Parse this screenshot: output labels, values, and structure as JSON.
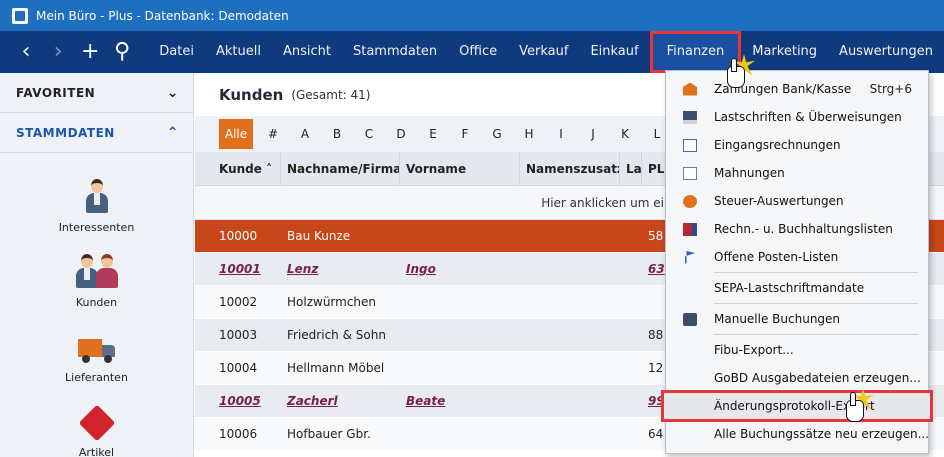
{
  "window": {
    "title": "Mein Büro - Plus - Datenbank: Demodaten"
  },
  "nav": {
    "back": "‹",
    "forward": "›",
    "new": "+",
    "search": "⚲"
  },
  "menu": [
    "Datei",
    "Aktuell",
    "Ansicht",
    "Stammdaten",
    "Office",
    "Verkauf",
    "Einkauf",
    "Finanzen",
    "Marketing",
    "Auswertungen"
  ],
  "sidebar": {
    "favoriten": "FAVORITEN",
    "stammdaten": "STAMMDATEN",
    "items": [
      {
        "label": "Interessenten",
        "icon": "person-icon"
      },
      {
        "label": "Kunden",
        "icon": "customers-icon"
      },
      {
        "label": "Lieferanten",
        "icon": "truck-icon"
      },
      {
        "label": "Artikel",
        "icon": "tag-icon"
      }
    ]
  },
  "main": {
    "title": "Kunden",
    "count": "(Gesamt: 41)",
    "alphabet": [
      "Alle",
      "#",
      "A",
      "B",
      "C",
      "D",
      "E",
      "F",
      "G",
      "H",
      "I",
      "J",
      "K",
      "L"
    ],
    "columns": [
      "Kunde",
      "Nachname/Firma",
      "Vorname",
      "Namenszusatz",
      "La",
      "PL"
    ],
    "filter_hint": "Hier anklicken um ei",
    "rows": [
      {
        "kunde": "10000",
        "name": "Bau Kunze",
        "vorname": "",
        "plz": "58",
        "style": "sel"
      },
      {
        "kunde": "10001",
        "name": "Lenz",
        "vorname": "Ingo",
        "plz": "63",
        "style": "bold"
      },
      {
        "kunde": "10002",
        "name": "Holzwürmchen",
        "vorname": "",
        "plz": "",
        "style": "plain"
      },
      {
        "kunde": "10003",
        "name": "Friedrich & Sohn",
        "vorname": "",
        "plz": "88",
        "style": "alt"
      },
      {
        "kunde": "10004",
        "name": "Hellmann Möbel",
        "vorname": "",
        "plz": "12",
        "style": "plain"
      },
      {
        "kunde": "10005",
        "name": "Zacherl",
        "vorname": "Beate",
        "plz": "99",
        "style": "bold"
      },
      {
        "kunde": "10006",
        "name": "Hofbauer Gbr.",
        "vorname": "",
        "plz": "64",
        "style": "plain"
      }
    ]
  },
  "finanzen_menu": {
    "items": [
      {
        "label": "Zahlungen Bank/Kasse",
        "shortcut": "Strg+6",
        "icon": "bank-icon"
      },
      {
        "label": "Lastschriften & Überweisungen",
        "shortcut": "",
        "icon": "card-icon"
      },
      {
        "label": "Eingangsrechnungen",
        "shortcut": "",
        "icon": "invoice-icon"
      },
      {
        "label": "Mahnungen",
        "shortcut": "",
        "icon": "reminder-icon"
      },
      {
        "label": "Steuer-Auswertungen",
        "shortcut": "",
        "icon": "tax-icon"
      },
      {
        "label": "Rechn.- u. Buchhaltungslisten",
        "shortcut": "",
        "icon": "ledger-icon"
      },
      {
        "label": "Offene Posten-Listen",
        "shortcut": "",
        "icon": "flag-icon"
      },
      {
        "label": "SEPA-Lastschriftmandate",
        "shortcut": "",
        "icon": ""
      },
      {
        "label": "Manuelle Buchungen",
        "shortcut": "",
        "icon": "manual-booking-icon"
      },
      {
        "label": "Fibu-Export...",
        "shortcut": "",
        "icon": ""
      },
      {
        "label": "GoBD Ausgabedateien erzeugen...",
        "shortcut": "",
        "icon": ""
      },
      {
        "label": "Änderungsprotokoll-Export",
        "shortcut": "",
        "icon": ""
      },
      {
        "label": "Alle Buchungssätze neu erzeugen...",
        "shortcut": "",
        "icon": ""
      }
    ]
  }
}
